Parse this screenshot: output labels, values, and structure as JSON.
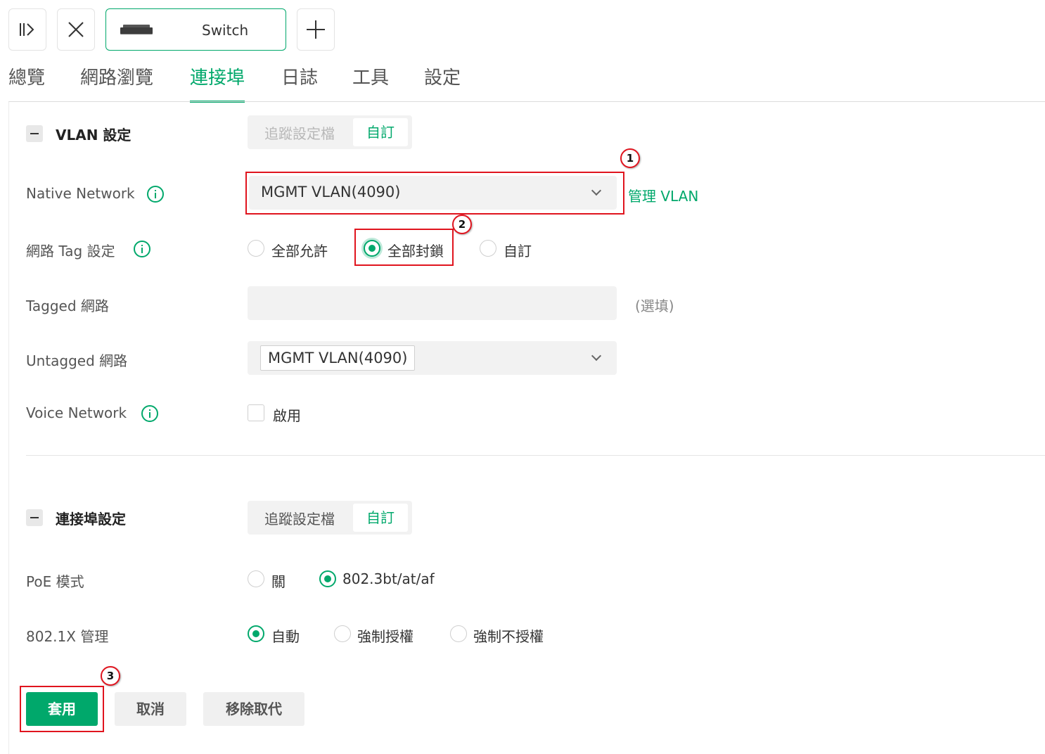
{
  "toolbar": {
    "expand_icon": "sidebar-expand-icon",
    "close_icon": "close-icon",
    "device_name": "Switch",
    "add_icon": "plus-icon"
  },
  "nav": {
    "tabs": [
      {
        "label": "總覽",
        "active": false
      },
      {
        "label": "網路瀏覽",
        "active": false
      },
      {
        "label": "連接埠",
        "active": true
      },
      {
        "label": "日誌",
        "active": false
      },
      {
        "label": "工具",
        "active": false
      },
      {
        "label": "設定",
        "active": false
      }
    ]
  },
  "vlan_section": {
    "title": "VLAN 設定",
    "profile_toggle": {
      "option1": "追蹤設定檔",
      "option2": "自訂",
      "selected": "自訂"
    },
    "native_network": {
      "label": "Native Network",
      "value": "MGMT VLAN(4090)",
      "manage_link": "管理 VLAN"
    },
    "tag_setting": {
      "label": "網路 Tag 設定",
      "options": [
        "全部允許",
        "全部封鎖",
        "自訂"
      ],
      "selected": "全部封鎖"
    },
    "tagged_network": {
      "label": "Tagged 網路",
      "value": "",
      "hint": "(選填)"
    },
    "untagged_network": {
      "label": "Untagged 網路",
      "value": "MGMT VLAN(4090)"
    },
    "voice_network": {
      "label": "Voice Network",
      "checkbox_label": "啟用",
      "checked": false
    }
  },
  "port_section": {
    "title": "連接埠設定",
    "profile_toggle": {
      "option1": "追蹤設定檔",
      "option2": "自訂",
      "selected": "自訂"
    },
    "poe_mode": {
      "label": "PoE 模式",
      "options": [
        "關",
        "802.3bt/at/af"
      ],
      "selected": "802.3bt/at/af"
    },
    "dot1x": {
      "label": "802.1X 管理",
      "options": [
        "自動",
        "強制授權",
        "強制不授權"
      ],
      "selected": "自動"
    }
  },
  "actions": {
    "apply": "套用",
    "cancel": "取消",
    "remove_override": "移除取代"
  },
  "annotations": {
    "step1": "1",
    "step2": "2",
    "step3": "3"
  },
  "colors": {
    "accent": "#00a86b",
    "highlight": "#e0141e"
  }
}
